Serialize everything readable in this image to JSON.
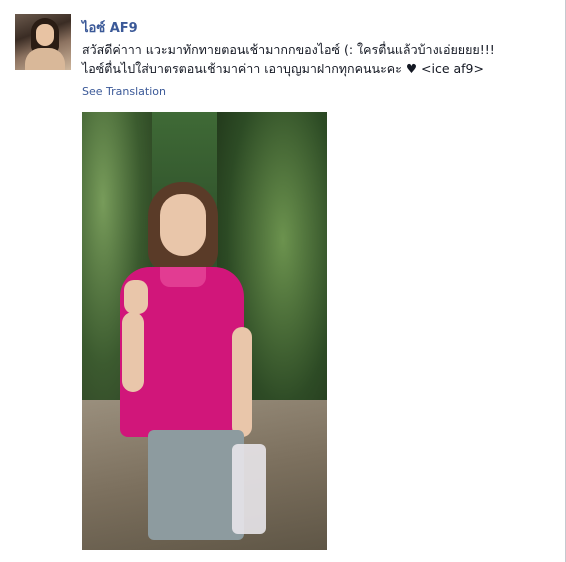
{
  "post": {
    "author_name": "ไอซ์ AF9",
    "message_line1": "สวัสดีค่าาา แวะมาทักทายตอนเช้ามากกของไอซ์ (: ใครตื่นแล้วบ้างเอ่ยยยย!!!",
    "message_line2": "ไอซ์ตื่นไปใส่บาตรตอนเช้ามาค่าา เอาบุญมาฝากทุกคนนะคะ ♥ <ice af9>",
    "see_translation": "See Translation"
  },
  "colors": {
    "link": "#3b5998",
    "text": "#141823",
    "shirt": "#d1167a"
  }
}
